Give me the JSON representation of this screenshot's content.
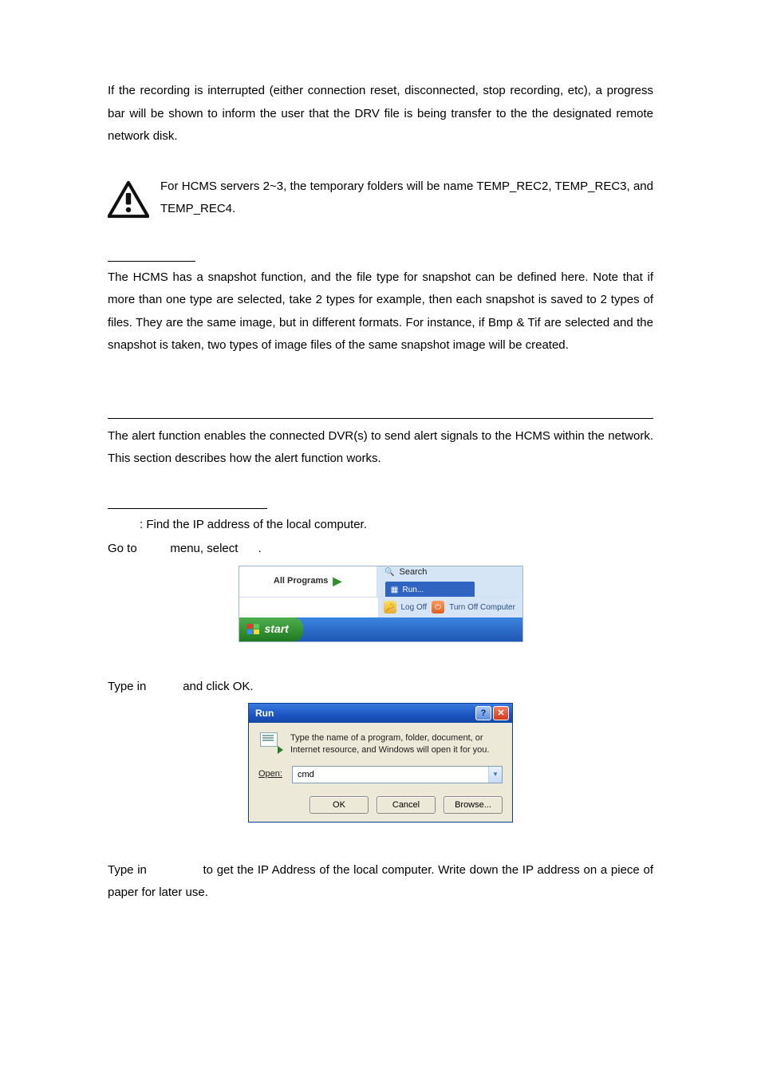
{
  "paragraphs": {
    "p1": "If the recording is interrupted (either connection reset, disconnected, stop recording, etc), a progress bar will be shown to inform the user that the DRV file is being transfer to the the designated remote network disk.",
    "note": "For HCMS servers 2~3, the temporary folders will be name TEMP_REC2, TEMP_REC3, and TEMP_REC4.",
    "p2": "The HCMS has a snapshot function, and the file type for snapshot can be defined here. Note that if more than one type are selected, take 2 types for example, then each snapshot is saved to 2 types of files. They are the same image, but in different formats. For instance, if Bmp & Tif are selected and the snapshot is taken, two types of image files of the same snapshot image will be created.",
    "p3": "The alert function enables the connected DVR(s) to send alert signals to the HCMS within the network. This section describes how the alert function works.",
    "step1": ": Find the IP address of the local computer.",
    "goto_a": "Go to ",
    "goto_b": " menu, select ",
    "goto_c": ".",
    "typein_a": "Type in ",
    "typein_b": " and click OK.",
    "bottom_a": "Type in ",
    "bottom_b": " to get the IP Address of the local computer. Write down the IP address on a piece of paper for later use."
  },
  "start_menu": {
    "all_programs": "All Programs",
    "search": "Search",
    "run": "Run...",
    "log_off": "Log Off",
    "turn_off": "Turn Off Computer",
    "start": "start"
  },
  "run_dialog": {
    "title": "Run",
    "desc": "Type the name of a program, folder, document, or Internet resource, and Windows will open it for you.",
    "open_label": "Open:",
    "open_value": "cmd",
    "ok": "OK",
    "cancel": "Cancel",
    "browse": "Browse..."
  }
}
